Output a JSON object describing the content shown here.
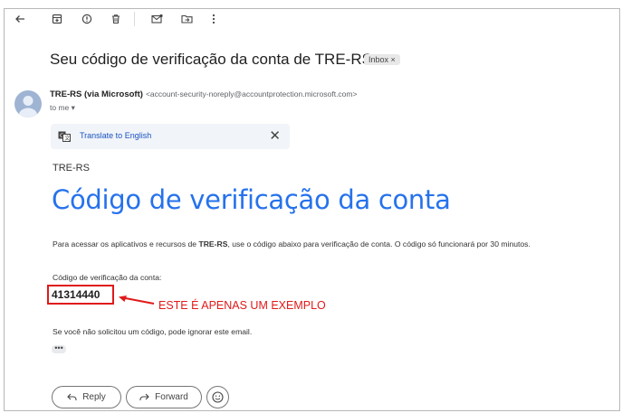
{
  "toolbar": {
    "icons": [
      "back-arrow-icon",
      "archive-icon",
      "report-spam-icon",
      "delete-icon",
      "mark-unread-icon",
      "move-to-icon",
      "more-options-icon"
    ]
  },
  "email": {
    "subject": "Seu código de verificação da conta de TRE-RS",
    "label": "Inbox ×",
    "sender_name": "TRE-RS (via Microsoft)",
    "sender_address": "<account-security-noreply@accountprotection.microsoft.com>",
    "to": "to me ▾"
  },
  "translate": {
    "link": "Translate to English",
    "close": "✕"
  },
  "body": {
    "brand": "TRE-RS",
    "title": "Código de verificação da conta",
    "paragraph_pre": "Para acessar os aplicativos e recursos de ",
    "paragraph_bold": "TRE-RS",
    "paragraph_post": ", use o código abaixo para verificação de conta. O código só funcionará por 30 minutos.",
    "code_label": "Código de verificação da conta:",
    "code": "41314440",
    "annotation": "ESTE É APENAS UM EXEMPLO",
    "ignore_text": "Se você não solicitou um código, pode ignorar este email.",
    "more": "•••"
  },
  "actions": {
    "reply": "Reply",
    "forward": "Forward"
  },
  "colors": {
    "title_blue": "#2672ec",
    "annotation_red": "#e01a1a",
    "link_blue": "#1a53c0"
  }
}
